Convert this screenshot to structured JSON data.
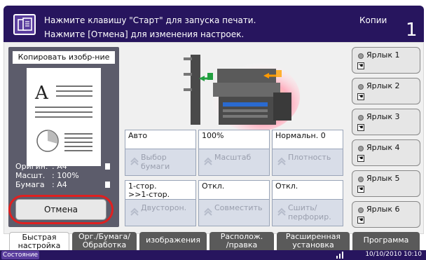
{
  "header": {
    "message_line1": "Нажмите клавишу \"Старт\" для запуска печати.",
    "message_line2": "Нажмите [Отмена] для изменения настроек.",
    "copies_label": "Копии",
    "copies_value": "1"
  },
  "preview": {
    "title": "Копировать изобр-ние",
    "page_letter": "A",
    "original_label": "Оригин.",
    "original_value": ": A4",
    "zoom_label": "Масшт.",
    "zoom_value": ": 100%",
    "paper_label": "Бумага",
    "paper_value": ": A4"
  },
  "cancel_button": {
    "label": "Отмена"
  },
  "settings": [
    {
      "value": "Авто",
      "label_line1": "Выбор",
      "label_line2": "бумаги"
    },
    {
      "value": "100%",
      "label_line1": "Масштаб",
      "label_line2": ""
    },
    {
      "value": "Нормальн. 0",
      "label_line1": "Плотность",
      "label_line2": ""
    },
    {
      "value_line1": "1-стор.",
      "value_line2": ">>1-стор.",
      "label_line1": "Двусторон.",
      "label_line2": ""
    },
    {
      "value": "Откл.",
      "label_line1": "Совместить",
      "label_line2": ""
    },
    {
      "value": "Откл.",
      "label_line1": "Сшить/",
      "label_line2": "перфорир."
    }
  ],
  "shortcuts": [
    {
      "label": "Ярлык 1"
    },
    {
      "label": "Ярлык 2"
    },
    {
      "label": "Ярлык 3"
    },
    {
      "label": "Ярлык 4"
    },
    {
      "label": "Ярлык 5"
    },
    {
      "label": "Ярлык 6"
    }
  ],
  "tabs": [
    {
      "line1": "Быстрая",
      "line2": "настройка"
    },
    {
      "line1": "Орг./Бумага/",
      "line2": "Обработка"
    },
    {
      "line1": "изображения",
      "line2": ""
    },
    {
      "line1": "Располож.",
      "line2": "/правка"
    },
    {
      "line1": "Расширенная",
      "line2": "установка"
    },
    {
      "line1": "Программа",
      "line2": ""
    }
  ],
  "status": {
    "label": "Состояние",
    "datetime": "10/10/2010  10:10"
  },
  "colors": {
    "header_bg": "#27155e",
    "cancel_highlight": "#e02020"
  }
}
